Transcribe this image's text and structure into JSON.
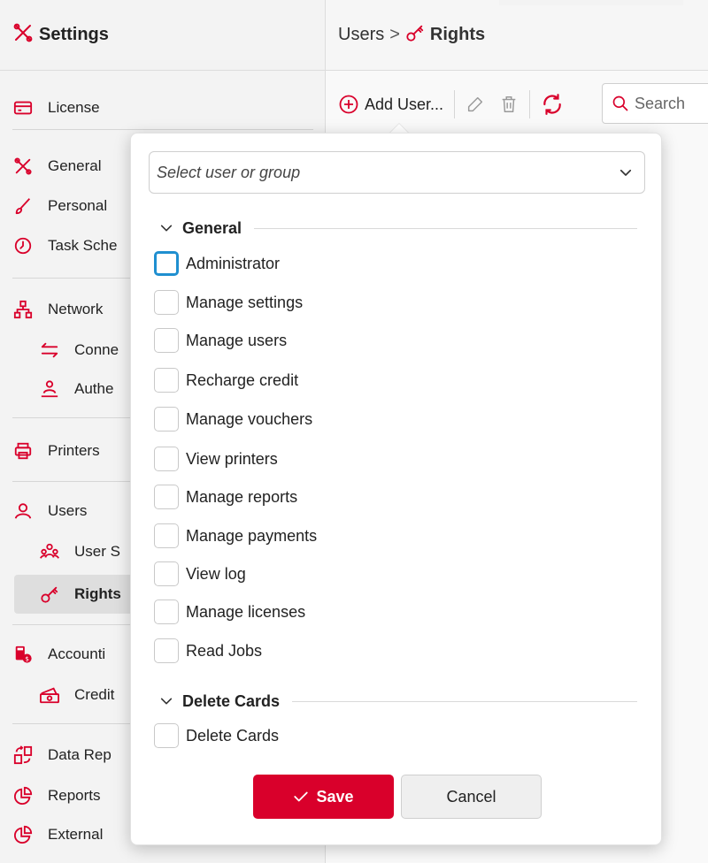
{
  "colors": {
    "accent": "#d9002b",
    "focus": "#1f8fd0"
  },
  "sidebar": {
    "title": "Settings",
    "items": [
      {
        "label": "License",
        "icon": "license-card-icon"
      },
      {
        "label": "General",
        "icon": "tools-icon"
      },
      {
        "label": "Personal",
        "icon": "brush-icon"
      },
      {
        "label": "Task Sche",
        "icon": "clock-icon"
      },
      {
        "label": "Network",
        "icon": "network-icon"
      },
      {
        "label": "Conne",
        "icon": "swap-arrows-icon"
      },
      {
        "label": "Authe",
        "icon": "user-auth-icon"
      },
      {
        "label": "Printers",
        "icon": "printer-icon"
      },
      {
        "label": "Users",
        "icon": "user-icon"
      },
      {
        "label": "User S",
        "icon": "user-group-icon"
      },
      {
        "label": "Rights",
        "icon": "key-icon"
      },
      {
        "label": "Accounti",
        "icon": "accounting-icon"
      },
      {
        "label": "Credit",
        "icon": "money-icon"
      },
      {
        "label": "Data Rep",
        "icon": "data-replication-icon"
      },
      {
        "label": "Reports",
        "icon": "pie-chart-icon"
      },
      {
        "label": "External",
        "icon": "pie-chart-icon"
      }
    ]
  },
  "main": {
    "breadcrumb": {
      "parent": "Users",
      "separator": ">",
      "current": "Rights"
    },
    "toolbar": {
      "add_user": "Add User...",
      "search_placeholder": "Search"
    }
  },
  "popover": {
    "select_placeholder": "Select user or group",
    "sections": [
      {
        "title": "General",
        "items": [
          "Administrator",
          "Manage settings",
          "Manage users",
          "Recharge credit",
          "Manage vouchers",
          "View printers",
          "Manage reports",
          "Manage payments",
          "View log",
          "Manage licenses",
          "Read Jobs"
        ]
      },
      {
        "title": "Delete Cards",
        "items": [
          "Delete Cards"
        ]
      }
    ],
    "save_label": "Save",
    "cancel_label": "Cancel"
  }
}
